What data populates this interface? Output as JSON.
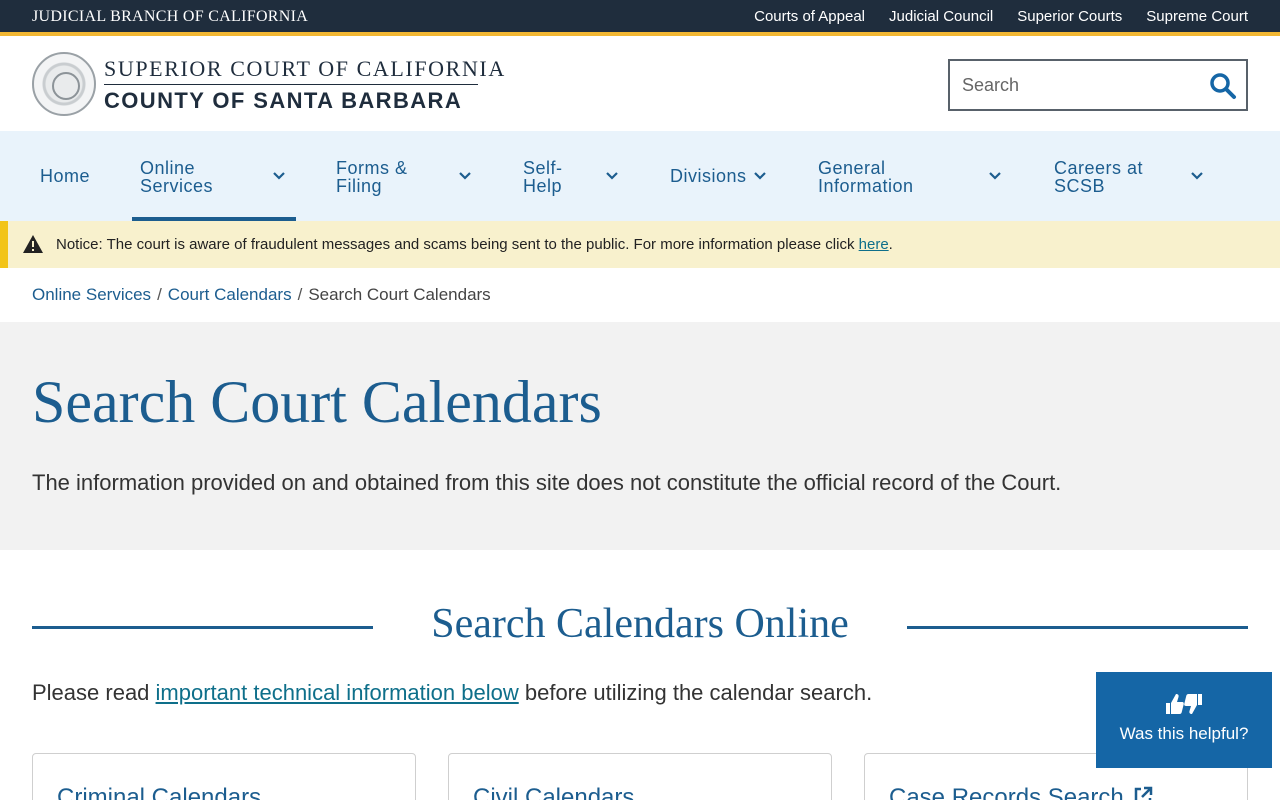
{
  "topbar": {
    "branch": "JUDICIAL BRANCH OF CALIFORNIA",
    "links": [
      "Courts of Appeal",
      "Judicial Council",
      "Superior Courts",
      "Supreme Court"
    ]
  },
  "header": {
    "line1": "SUPERIOR COURT OF CALIFORNIA",
    "line2": "COUNTY OF SANTA BARBARA",
    "search_placeholder": "Search"
  },
  "nav": {
    "items": [
      {
        "label": "Home"
      },
      {
        "label": "Online Services"
      },
      {
        "label": "Forms & Filing"
      },
      {
        "label": "Self-Help"
      },
      {
        "label": "Divisions"
      },
      {
        "label": "General Information"
      },
      {
        "label": "Careers at SCSB"
      }
    ],
    "active": "Online Services"
  },
  "notice": {
    "prefix": "Notice:",
    "text": "The court is aware of fraudulent messages and scams being sent to the public. For more information please click",
    "link": "here",
    "suffix": "."
  },
  "breadcrumb": [
    "Online Services",
    "Court Calendars",
    "Search Court Calendars"
  ],
  "hero": {
    "title": "Search Court Calendars",
    "subtitle": "The information provided on and obtained from this site does not constitute the official record of the Court."
  },
  "section": {
    "title": "Search Calendars Online",
    "intro_before": "Please read",
    "intro_link": "important technical information below",
    "intro_after": "before utilizing the calendar search."
  },
  "cards": [
    "Criminal Calendars",
    "Civil Calendars",
    "Case Records Search"
  ],
  "helpful": {
    "label": "Was this helpful?"
  },
  "colors": {
    "brand_blue": "#1c5d8f",
    "topbar": "#1f2d3d",
    "accent_gold": "#f2b733",
    "notice_bg": "#f8f1cd"
  }
}
